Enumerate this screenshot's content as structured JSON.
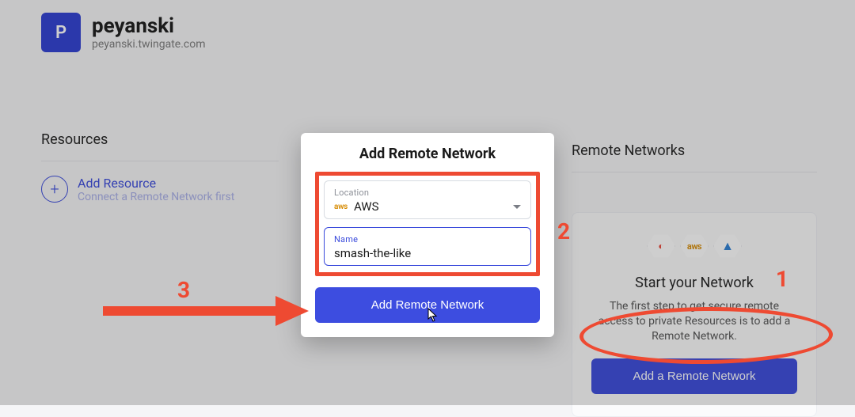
{
  "header": {
    "avatar_initial": "P",
    "org_name": "peyanski",
    "org_domain": "peyanski.twingate.com"
  },
  "resources": {
    "heading": "Resources",
    "add_title": "Add Resource",
    "add_sub": "Connect a Remote Network first"
  },
  "remote_networks": {
    "heading": "Remote Networks",
    "card_title": "Start your Network",
    "card_desc": "The first step to get secure remote access to private Resources is to add a Remote Network.",
    "cta": "Add a Remote Network",
    "providers": {
      "gcp": "gcp",
      "aws": "aws",
      "azure": "azure"
    }
  },
  "modal": {
    "title": "Add Remote Network",
    "location_label": "Location",
    "location_value": "AWS",
    "location_provider_tag": "aws",
    "name_label": "Name",
    "name_value": "smash-the-like",
    "submit": "Add Remote Network"
  },
  "annotations": {
    "step1": "1",
    "step2": "2",
    "step3": "3"
  },
  "colors": {
    "accent_red": "#ee4a32",
    "brand_blue": "#3b4bdc"
  }
}
